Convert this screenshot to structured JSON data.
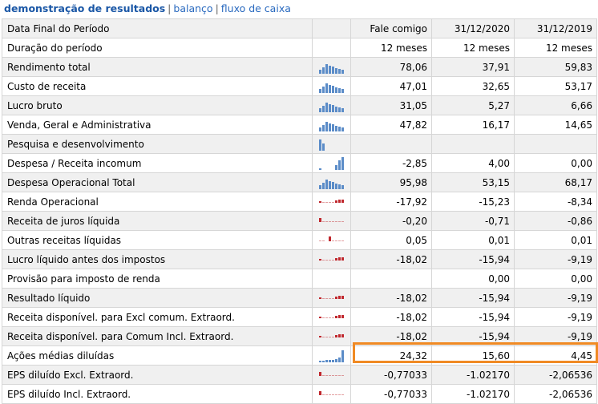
{
  "nav": {
    "active": "demonstração de resultados",
    "separator": "|",
    "links": [
      "balanço",
      "fluxo de caixa"
    ]
  },
  "colors": {
    "bar_blue": "#5b8cc8",
    "bar_red": "#c0272d",
    "highlight": "#f08a24",
    "row_alt": "#f0f0f0",
    "border": "#d6d6d6"
  },
  "table": {
    "header": [
      "Data Final do Período",
      "",
      "Fale comigo",
      "31/12/2020",
      "31/12/2019"
    ],
    "rows": [
      {
        "label": "Duração do período",
        "spark": "none",
        "values": [
          "12 meses",
          "12 meses",
          "12 meses"
        ]
      },
      {
        "label": "Rendimento total",
        "spark": "blue",
        "values": [
          "78,06",
          "37,91",
          "59,83"
        ]
      },
      {
        "label": "Custo de receita",
        "spark": "blue",
        "values": [
          "47,01",
          "32,65",
          "53,17"
        ]
      },
      {
        "label": "Lucro bruto",
        "spark": "blue",
        "values": [
          "31,05",
          "5,27",
          "6,66"
        ]
      },
      {
        "label": "Venda, Geral e Administrativa",
        "spark": "blue",
        "values": [
          "47,82",
          "16,17",
          "14,65"
        ]
      },
      {
        "label": "Pesquisa e desenvolvimento",
        "spark": "blue-few",
        "values": [
          "",
          "",
          ""
        ]
      },
      {
        "label": "Despesa / Receita incomum",
        "spark": "blue-rise",
        "values": [
          "-2,85",
          "4,00",
          "0,00"
        ]
      },
      {
        "label": "Despesa Operacional Total",
        "spark": "blue",
        "values": [
          "95,98",
          "53,15",
          "68,17"
        ]
      },
      {
        "label": "Renda Operacional",
        "spark": "red",
        "values": [
          "-17,92",
          "-15,23",
          "-8,34"
        ]
      },
      {
        "label": "Receita de juros líquida",
        "spark": "red-left",
        "values": [
          "-0,20",
          "-0,71",
          "-0,86"
        ]
      },
      {
        "label": "Outras receitas líquidas",
        "spark": "red-mid",
        "values": [
          "0,05",
          "0,01",
          "0,01"
        ]
      },
      {
        "label": "Lucro líquido antes dos impostos",
        "spark": "red",
        "values": [
          "-18,02",
          "-15,94",
          "-9,19"
        ]
      },
      {
        "label": "Provisão para imposto de renda",
        "spark": "none",
        "values": [
          "",
          "0,00",
          "0,00"
        ]
      },
      {
        "label": "Resultado líquido",
        "spark": "red",
        "values": [
          "-18,02",
          "-15,94",
          "-9,19"
        ]
      },
      {
        "label": "Receita disponível. para Excl comum. Extraord.",
        "spark": "red",
        "values": [
          "-18,02",
          "-15,94",
          "-9,19"
        ]
      },
      {
        "label": "Receita disponível. para Comum Incl. Extraord.",
        "spark": "red",
        "values": [
          "-18,02",
          "-15,94",
          "-9,19"
        ]
      },
      {
        "label": "Ações médias diluídas",
        "spark": "blue-grow",
        "values": [
          "24,32",
          "15,60",
          "4,45"
        ]
      },
      {
        "label": "EPS diluído Excl. Extraord.",
        "spark": "red-left",
        "values": [
          "-0,77033",
          "-1.02170",
          "-2,06536"
        ]
      },
      {
        "label": "EPS diluído Incl. Extraord.",
        "spark": "red-left",
        "values": [
          "-0,77033",
          "-1.02170",
          "-2,06536"
        ]
      }
    ]
  }
}
